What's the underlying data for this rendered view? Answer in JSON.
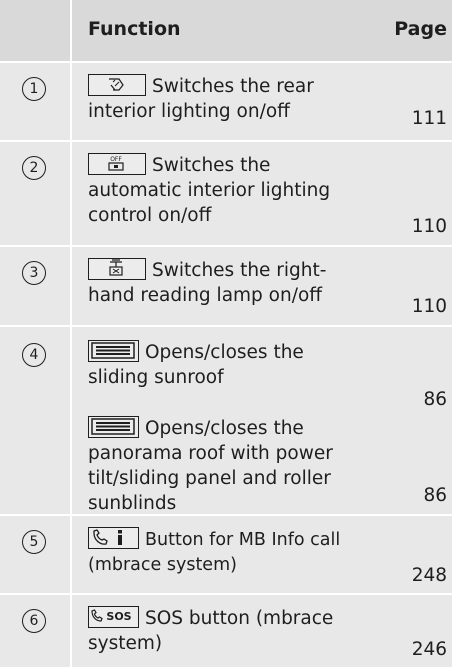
{
  "header": {
    "function": "Function",
    "page": "Page"
  },
  "rows": [
    {
      "num": "1",
      "icon": "rear-interior-light-icon",
      "text": "Switches the rear interior lighting on/off",
      "page": "111"
    },
    {
      "num": "2",
      "icon": "auto-interior-light-off-icon",
      "text": "Switches the automatic interior lighting control on/off",
      "page": "110",
      "icon_text": "OFF"
    },
    {
      "num": "3",
      "icon": "reading-lamp-icon",
      "text": "Switches the right-hand reading lamp on/off",
      "page": "110"
    },
    {
      "num": "4",
      "icon": "sunroof-icon",
      "text": "Opens/closes the sliding sunroof",
      "page": "86",
      "text2": "Opens/closes the panorama roof with power tilt/sliding panel and roller sunblinds",
      "page2": "86"
    },
    {
      "num": "5",
      "icon": "info-call-icon",
      "text": "Button for MB Info call (mbrace system)",
      "page": "248"
    },
    {
      "num": "6",
      "icon": "sos-icon",
      "text": "SOS button (mbrace system)",
      "page": "246",
      "icon_text": "SOS"
    }
  ]
}
